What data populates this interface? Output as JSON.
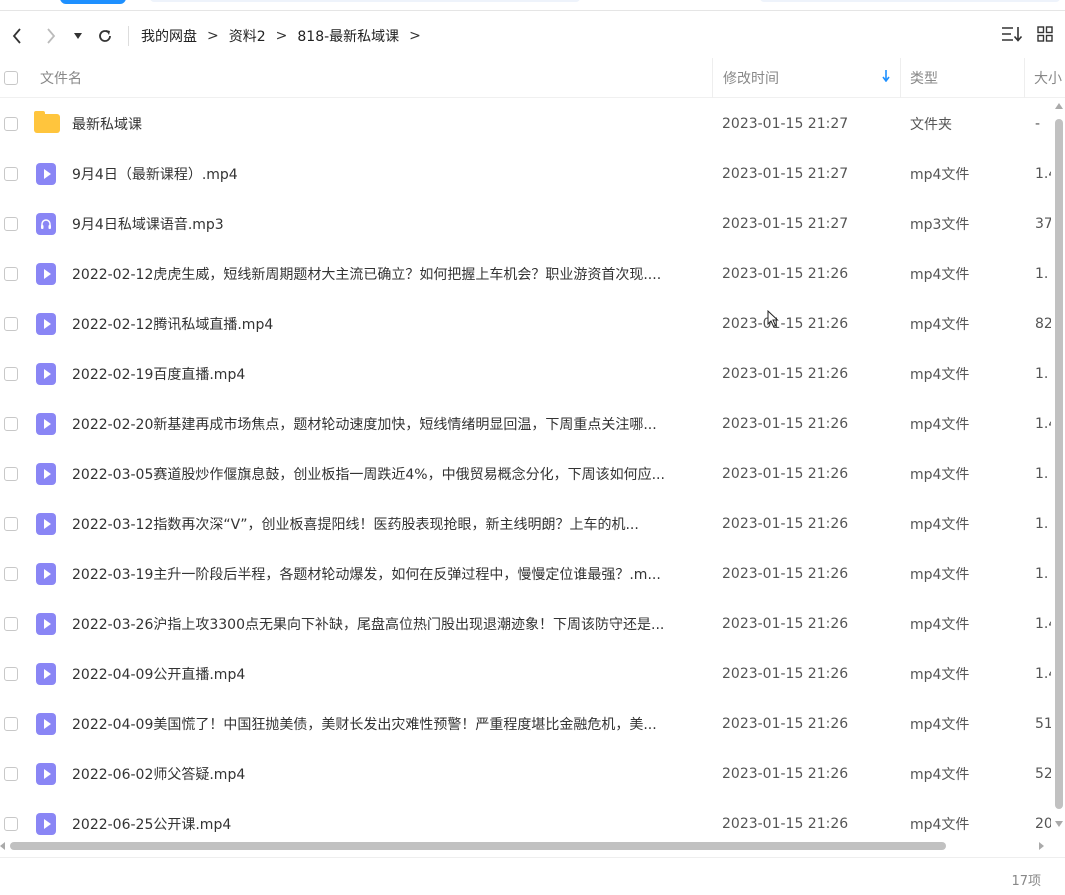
{
  "toolbar": {
    "back_icon": "chevron-left-icon",
    "forward_icon": "chevron-right-icon",
    "history_dropdown_icon": "triangle-down-icon",
    "refresh_icon": "refresh-icon",
    "sort_icon": "sort-list-icon",
    "grid_icon": "grid-view-icon"
  },
  "breadcrumb": {
    "items": [
      "我的网盘",
      "资料2",
      "818-最新私域课"
    ],
    "separator": ">"
  },
  "columns": {
    "name": "文件名",
    "modified": "修改时间",
    "type": "类型",
    "size": "大小"
  },
  "files": [
    {
      "name": "最新私域课",
      "icon": "folder-icon",
      "modified": "2023-01-15 21:27",
      "type": "文件夹",
      "size": "-"
    },
    {
      "name": "9月4日（最新课程）.mp4",
      "icon": "video-file-icon",
      "modified": "2023-01-15 21:27",
      "type": "mp4文件",
      "size": "1.4"
    },
    {
      "name": "9月4日私域课语音.mp3",
      "icon": "audio-file-icon",
      "modified": "2023-01-15 21:27",
      "type": "mp3文件",
      "size": "37"
    },
    {
      "name": "2022-02-12虎虎生威，短线新周期题材大主流已确立？如何把握上车机会？职业游资首次现....",
      "icon": "video-file-icon",
      "modified": "2023-01-15 21:26",
      "type": "mp4文件",
      "size": "1."
    },
    {
      "name": "2022-02-12腾讯私域直播.mp4",
      "icon": "video-file-icon",
      "modified": "2023-01-15 21:26",
      "type": "mp4文件",
      "size": "82"
    },
    {
      "name": "2022-02-19百度直播.mp4",
      "icon": "video-file-icon",
      "modified": "2023-01-15 21:26",
      "type": "mp4文件",
      "size": "1."
    },
    {
      "name": "2022-02-20新基建再成市场焦点，题材轮动速度加快，短线情绪明显回温，下周重点关注哪...",
      "icon": "video-file-icon",
      "modified": "2023-01-15 21:26",
      "type": "mp4文件",
      "size": "1.4"
    },
    {
      "name": "2022-03-05赛道股炒作偃旗息鼓，创业板指一周跌近4%，中俄贸易概念分化，下周该如何应...",
      "icon": "video-file-icon",
      "modified": "2023-01-15 21:26",
      "type": "mp4文件",
      "size": "1."
    },
    {
      "name": "2022-03-12指数再次深“V”，创业板喜提阳线！医药股表现抢眼，新主线明朗？上车的机...",
      "icon": "video-file-icon",
      "modified": "2023-01-15 21:26",
      "type": "mp4文件",
      "size": "1."
    },
    {
      "name": "2022-03-19主升一阶段后半程，各题材轮动爆发，如何在反弹过程中，慢慢定位谁最强？.m...",
      "icon": "video-file-icon",
      "modified": "2023-01-15 21:26",
      "type": "mp4文件",
      "size": "1."
    },
    {
      "name": "2022-03-26沪指上攻3300点无果向下补缺，尾盘高位热门股出现退潮迹象！下周该防守还是...",
      "icon": "video-file-icon",
      "modified": "2023-01-15 21:26",
      "type": "mp4文件",
      "size": "1.4"
    },
    {
      "name": "2022-04-09公开直播.mp4",
      "icon": "video-file-icon",
      "modified": "2023-01-15 21:26",
      "type": "mp4文件",
      "size": "1.4"
    },
    {
      "name": "2022-04-09美国慌了！中国狂抛美债，美财长发出灾难性预警！严重程度堪比金融危机，美...",
      "icon": "video-file-icon",
      "modified": "2023-01-15 21:26",
      "type": "mp4文件",
      "size": "51"
    },
    {
      "name": "2022-06-02师父答疑.mp4",
      "icon": "video-file-icon",
      "modified": "2023-01-15 21:26",
      "type": "mp4文件",
      "size": "52"
    },
    {
      "name": "2022-06-25公开课.mp4",
      "icon": "video-file-icon",
      "modified": "2023-01-15 21:26",
      "type": "mp4文件",
      "size": "20"
    }
  ],
  "footer": {
    "count": "17项"
  },
  "colors": {
    "accent": "#1e90ff",
    "folder": "#ffc53d",
    "media_icon": "#8a86f5"
  }
}
